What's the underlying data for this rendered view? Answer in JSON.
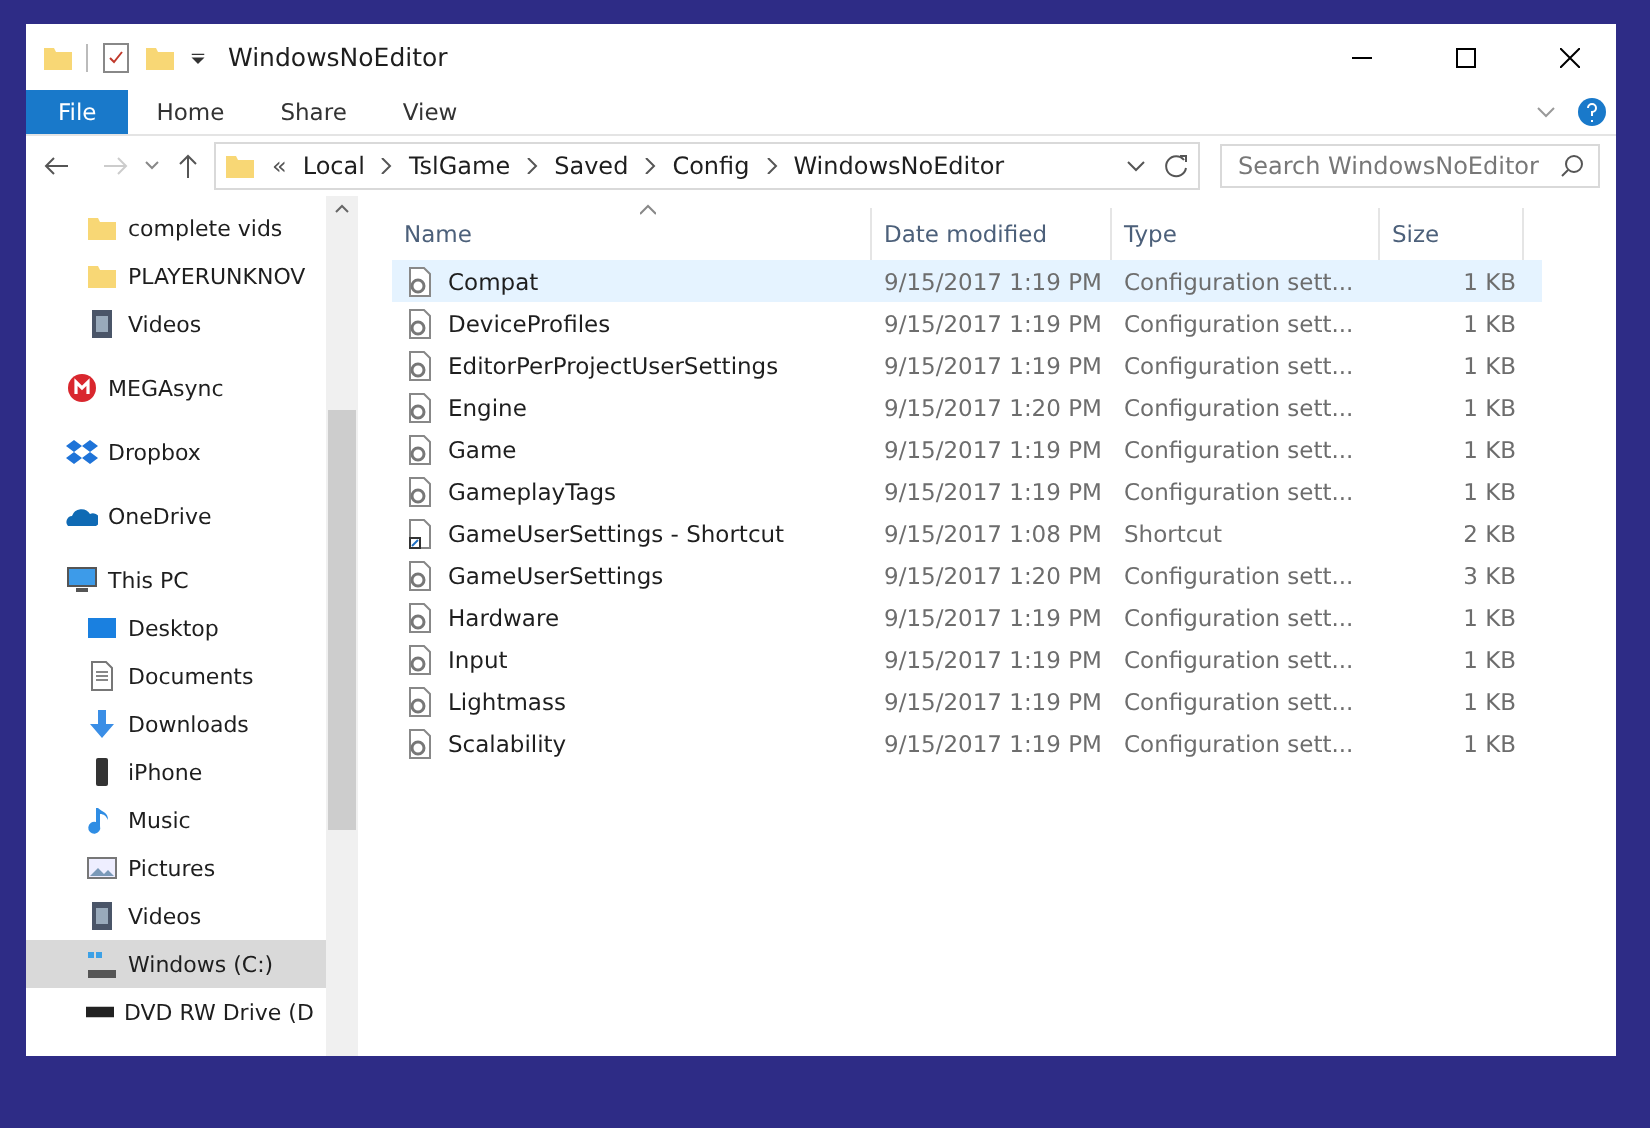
{
  "window": {
    "title": "WindowsNoEditor"
  },
  "ribbon_tabs": [
    {
      "label": "File",
      "kind": "file",
      "selected": false
    },
    {
      "label": "Home",
      "kind": "tab",
      "selected": false
    },
    {
      "label": "Share",
      "kind": "tab",
      "selected": false
    },
    {
      "label": "View",
      "kind": "tab",
      "selected": false
    }
  ],
  "address_bar": {
    "overflow": "«",
    "path": [
      "Local",
      "TslGame",
      "Saved",
      "Config",
      "WindowsNoEditor"
    ]
  },
  "search": {
    "placeholder": "Search WindowsNoEditor"
  },
  "sidebar": {
    "quick_access": [
      {
        "label": "complete vids",
        "kind": "folder",
        "selected": false
      },
      {
        "label": "PLAYERUNKNOV",
        "kind": "folder",
        "selected": false
      },
      {
        "label": "Videos",
        "kind": "video",
        "selected": false
      }
    ],
    "items": [
      {
        "label": "MEGAsync",
        "kind": "mega",
        "selected": false
      },
      {
        "label": "Dropbox",
        "kind": "dropbox",
        "selected": false
      },
      {
        "label": "OneDrive",
        "kind": "onedrive",
        "selected": false
      },
      {
        "label": "This PC",
        "kind": "pc",
        "selected": false,
        "children": [
          {
            "label": "Desktop",
            "kind": "desktop",
            "selected": false
          },
          {
            "label": "Documents",
            "kind": "documents",
            "selected": false
          },
          {
            "label": "Downloads",
            "kind": "downloads",
            "selected": false
          },
          {
            "label": "iPhone",
            "kind": "phone",
            "selected": false
          },
          {
            "label": "Music",
            "kind": "music",
            "selected": false
          },
          {
            "label": "Pictures",
            "kind": "pictures",
            "selected": false
          },
          {
            "label": "Videos",
            "kind": "video",
            "selected": false
          },
          {
            "label": "Windows (C:)",
            "kind": "drive",
            "selected": true
          },
          {
            "label": "DVD RW Drive (D",
            "kind": "dvd",
            "selected": false
          }
        ]
      }
    ]
  },
  "file_list": {
    "columns": [
      "Name",
      "Date modified",
      "Type",
      "Size"
    ],
    "rows": [
      {
        "name": "Compat",
        "date": "9/15/2017 1:19 PM",
        "type": "Configuration sett...",
        "size": "1 KB",
        "kind": "config",
        "selected": true
      },
      {
        "name": "DeviceProfiles",
        "date": "9/15/2017 1:19 PM",
        "type": "Configuration sett...",
        "size": "1 KB",
        "kind": "config",
        "selected": false
      },
      {
        "name": "EditorPerProjectUserSettings",
        "date": "9/15/2017 1:19 PM",
        "type": "Configuration sett...",
        "size": "1 KB",
        "kind": "config",
        "selected": false
      },
      {
        "name": "Engine",
        "date": "9/15/2017 1:20 PM",
        "type": "Configuration sett...",
        "size": "1 KB",
        "kind": "config",
        "selected": false
      },
      {
        "name": "Game",
        "date": "9/15/2017 1:19 PM",
        "type": "Configuration sett...",
        "size": "1 KB",
        "kind": "config",
        "selected": false
      },
      {
        "name": "GameplayTags",
        "date": "9/15/2017 1:19 PM",
        "type": "Configuration sett...",
        "size": "1 KB",
        "kind": "config",
        "selected": false
      },
      {
        "name": "GameUserSettings - Shortcut",
        "date": "9/15/2017 1:08 PM",
        "type": "Shortcut",
        "size": "2 KB",
        "kind": "shortcut",
        "selected": false
      },
      {
        "name": "GameUserSettings",
        "date": "9/15/2017 1:20 PM",
        "type": "Configuration sett...",
        "size": "3 KB",
        "kind": "config",
        "selected": false
      },
      {
        "name": "Hardware",
        "date": "9/15/2017 1:19 PM",
        "type": "Configuration sett...",
        "size": "1 KB",
        "kind": "config",
        "selected": false
      },
      {
        "name": "Input",
        "date": "9/15/2017 1:19 PM",
        "type": "Configuration sett...",
        "size": "1 KB",
        "kind": "config",
        "selected": false
      },
      {
        "name": "Lightmass",
        "date": "9/15/2017 1:19 PM",
        "type": "Configuration sett...",
        "size": "1 KB",
        "kind": "config",
        "selected": false
      },
      {
        "name": "Scalability",
        "date": "9/15/2017 1:19 PM",
        "type": "Configuration sett...",
        "size": "1 KB",
        "kind": "config",
        "selected": false
      }
    ]
  }
}
